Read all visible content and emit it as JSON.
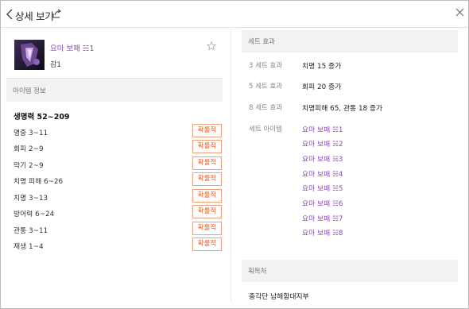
{
  "header": {
    "title": "상세 보기"
  },
  "item": {
    "name": "요마 보패 ☵1",
    "tier": "감1"
  },
  "item_info": {
    "section_title": "아이템 정보",
    "main_stat": "생명력 52~209",
    "prob_label": "확률적",
    "stats": [
      {
        "label": "명중 3~11"
      },
      {
        "label": "회피 2~9"
      },
      {
        "label": "막기 2~9"
      },
      {
        "label": "치명 피해 6~26"
      },
      {
        "label": "치명 3~13"
      },
      {
        "label": "방어력 6~24"
      },
      {
        "label": "관통 3~11"
      },
      {
        "label": "재생 1~4"
      }
    ]
  },
  "set_effect": {
    "section_title": "세트 효과",
    "effects": [
      {
        "key": "3 세트 효과",
        "value": "치명 15 증가"
      },
      {
        "key": "5 세트 효과",
        "value": "회피 20 증가"
      },
      {
        "key": "8 세트 효과",
        "value": "치명피해 65, 관통 18 증가"
      }
    ],
    "items_label": "세트 아이템",
    "items": [
      "요마 보패 ☵1",
      "요마 보패 ☵2",
      "요마 보패 ☵3",
      "요마 보패 ☵4",
      "요마 보패 ☵5",
      "요마 보패 ☵6",
      "요마 보패 ☵7",
      "요마 보패 ☵8"
    ]
  },
  "source": {
    "section_title": "획득처",
    "text": "충각단 남해함대지부"
  },
  "colors": {
    "accent_purple": "#8a4fb4",
    "prob_orange": "#e6622c",
    "section_bg": "#f2f2f2"
  },
  "icons": {
    "back": "chevron-left-icon",
    "share": "share-icon",
    "close": "close-icon",
    "favorite": "star-outline-icon"
  }
}
